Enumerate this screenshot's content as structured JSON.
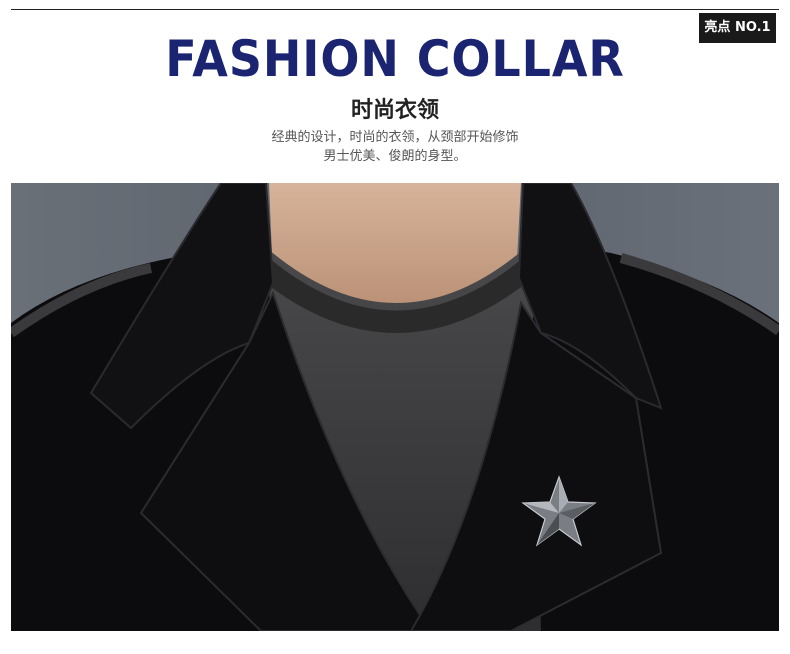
{
  "badge": {
    "text": "亮点 NO.1"
  },
  "header": {
    "title": "FASHION COLLAR",
    "subtitle": "时尚衣领",
    "desc_line1": "经典的设计，时尚的衣领，从颈部开始修饰",
    "desc_line2": "男士优美、俊朗的身型。"
  },
  "photo": {
    "icon": "product-photo-collar-star-pin",
    "colors": {
      "coat": "#0b0b0d",
      "sweater": "#3a3a3c",
      "skin": "#caa48a",
      "background": "#5c646e"
    }
  }
}
